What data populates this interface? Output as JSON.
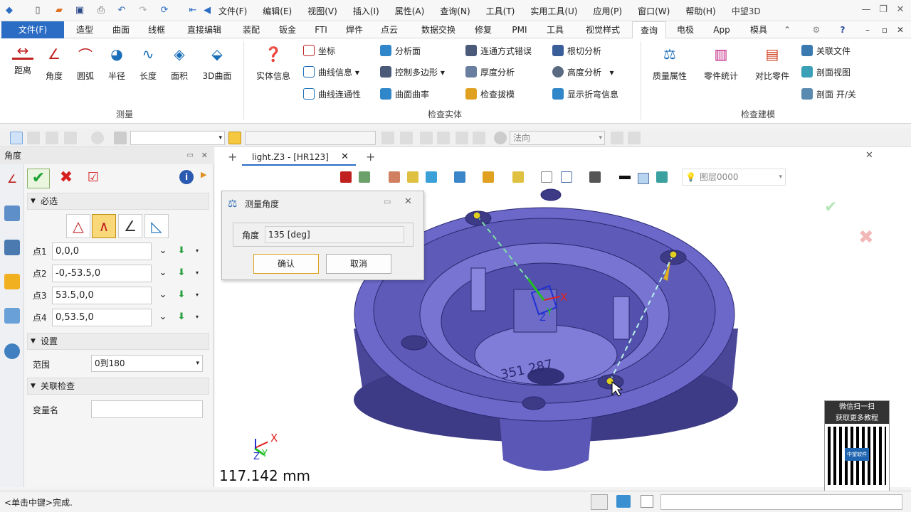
{
  "title_bar": {
    "menus": [
      "文件(F)",
      "编辑(E)",
      "视图(V)",
      "插入(I)",
      "属性(A)",
      "查询(N)",
      "工具(T)",
      "实用工具(U)",
      "应用(P)",
      "窗口(W)",
      "帮助(H)"
    ],
    "app_name": "中望3D"
  },
  "ribbon_tabs": [
    "文件(F)",
    "造型",
    "曲面",
    "线框",
    "直接编辑",
    "装配",
    "钣金",
    "FTI",
    "焊件",
    "点云",
    "数据交换",
    "修复",
    "PMI",
    "工具",
    "视觉样式",
    "查询",
    "电极",
    "App",
    "模具"
  ],
  "ribbon": {
    "measure_group": {
      "label": "测量",
      "items": [
        "距离",
        "角度",
        "圆弧",
        "半径",
        "长度",
        "面积",
        "3D曲面"
      ]
    },
    "check_entity_group": {
      "label": "检查实体",
      "big_item": "实体信息",
      "col1": [
        "坐标",
        "曲线信息",
        "曲线连通性"
      ],
      "col2": [
        "分析面",
        "控制多边形",
        "曲面曲率"
      ],
      "col3": [
        "连通方式错误",
        "厚度分析",
        "检查拔模"
      ],
      "col4": [
        "根切分析",
        "高度分析",
        "显示折弯信息"
      ]
    },
    "check_model_group": {
      "label": "检查建模",
      "big_items": [
        "质量属性",
        "零件统计",
        "对比零件"
      ],
      "side_items": [
        "关联文件",
        "剖面视图",
        "剖面 开/关"
      ]
    }
  },
  "toolbar2": {
    "direction_label": "法向"
  },
  "left_panel": {
    "title": "角度",
    "required_label": "必选",
    "points": [
      {
        "label": "点1",
        "value": "0,0,0"
      },
      {
        "label": "点2",
        "value": "-0,-53.5,0"
      },
      {
        "label": "点3",
        "value": "53.5,0,0"
      },
      {
        "label": "点4",
        "value": "0,53.5,0"
      }
    ],
    "settings_label": "设置",
    "range_label": "范围",
    "range_value": "0到180",
    "assoc_label": "关联检查",
    "var_label": "变量名",
    "var_value": ""
  },
  "document_tab": {
    "name": "light.Z3 - [HR123]"
  },
  "viewport_toolbar": {
    "layer": "图层0000"
  },
  "dialog": {
    "title": "测量角度",
    "field_label": "角度",
    "field_value": "135  [deg]",
    "ok": "确认",
    "cancel": "取消"
  },
  "viewport": {
    "measurement": "117.142 mm",
    "part_text": "351 287",
    "axis_x": "X",
    "axis_y": "Y",
    "axis_z": "Z",
    "qr_line1": "微信扫一扫",
    "qr_line2": "获取更多教程",
    "qr_center": "中望软件"
  },
  "status": {
    "hint": "<单击中键>完成."
  },
  "colors": {
    "accent": "#2b6cc4",
    "part": "#6b68c9",
    "part_dark": "#4b47a0",
    "measure_line": "#7fe3a6",
    "ok_green": "#1ea336",
    "cancel_red": "#d62020"
  }
}
